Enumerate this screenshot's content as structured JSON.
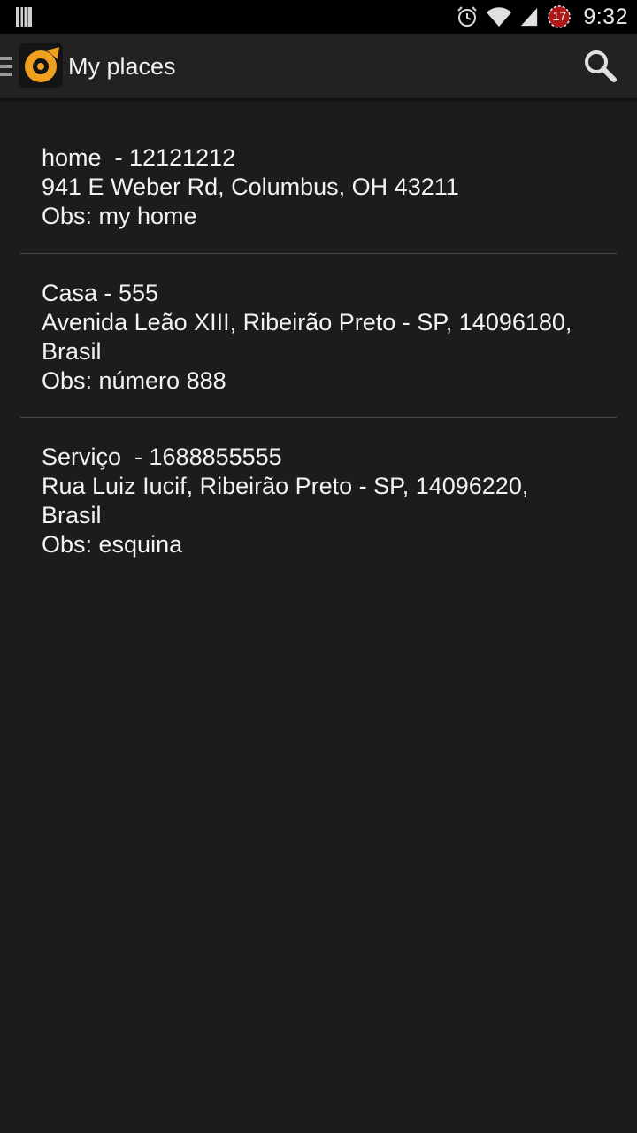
{
  "status_bar": {
    "time": "9:32",
    "calendar_badge": "17",
    "icons": [
      "storage-icon",
      "alarm-icon",
      "wifi-icon",
      "signal-icon",
      "calendar-notification-icon"
    ]
  },
  "action_bar": {
    "title": "My places",
    "icons": [
      "drawer-indicator-icon",
      "app-logo-icon",
      "search-icon"
    ],
    "logo_color": "#f0a020"
  },
  "places": [
    {
      "title": "home  - 12121212",
      "address_line1": "941 E Weber Rd, Columbus, OH 43211",
      "address_line2": "",
      "obs": "Obs: my home"
    },
    {
      "title": "Casa - 555",
      "address_line1": "Avenida Leão XIII, Ribeirão Preto - SP, 14096180,",
      "address_line2": "Brasil",
      "obs": "Obs: número 888"
    },
    {
      "title": "Serviço  - 1688855555",
      "address_line1": "Rua Luiz Iucif, Ribeirão Preto - SP, 14096220,",
      "address_line2": "Brasil",
      "obs": "Obs: esquina"
    }
  ]
}
